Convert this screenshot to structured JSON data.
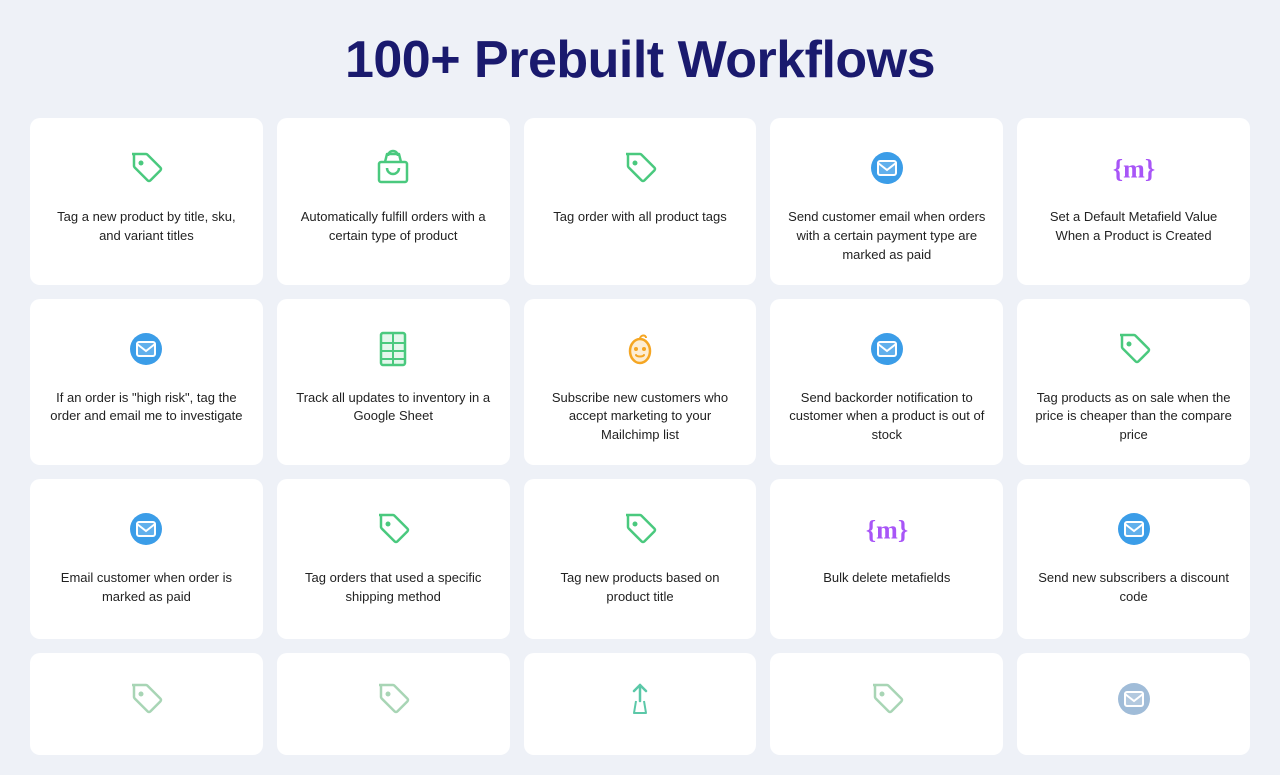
{
  "page": {
    "title": "100+ Prebuilt Workflows"
  },
  "cards": [
    {
      "id": "tag-new-product",
      "icon": "tag",
      "icon_color": "#4ac97e",
      "text": "Tag a new product by title, sku, and variant titles"
    },
    {
      "id": "auto-fulfill",
      "icon": "shopify-bag",
      "icon_color": "#4ac97e",
      "text": "Automatically fulfill orders with a certain type of product"
    },
    {
      "id": "tag-order-product-tags",
      "icon": "tag",
      "icon_color": "#4ac97e",
      "text": "Tag order with all product tags"
    },
    {
      "id": "email-payment-type",
      "icon": "email",
      "icon_color": "#3b9de8",
      "text": "Send customer email when orders with a certain payment type are marked as paid"
    },
    {
      "id": "set-metafield",
      "icon": "metafield",
      "icon_color": "#a855f7",
      "text": "Set a Default Metafield Value When a Product is Created"
    },
    {
      "id": "high-risk-order",
      "icon": "email",
      "icon_color": "#3b9de8",
      "text": "If an order is \"high risk\", tag the order and email me to investigate"
    },
    {
      "id": "track-inventory-sheet",
      "icon": "google-sheet",
      "icon_color": "#4ac97e",
      "text": "Track all updates to inventory in a Google Sheet"
    },
    {
      "id": "mailchimp-subscribe",
      "icon": "mailchimp",
      "icon_color": "#f5a623",
      "text": "Subscribe new customers who accept marketing to your Mailchimp list"
    },
    {
      "id": "backorder-notification",
      "icon": "email",
      "icon_color": "#3b9de8",
      "text": "Send backorder notification to customer when a product is out of stock"
    },
    {
      "id": "tag-on-sale",
      "icon": "tag",
      "icon_color": "#4ac97e",
      "text": "Tag products as on sale when the price is cheaper than the compare price"
    },
    {
      "id": "email-order-paid",
      "icon": "email",
      "icon_color": "#3b9de8",
      "text": "Email customer when order is marked as paid"
    },
    {
      "id": "tag-shipping-method",
      "icon": "tag",
      "icon_color": "#4ac97e",
      "text": "Tag orders that used a specific shipping method"
    },
    {
      "id": "tag-new-products-title",
      "icon": "tag",
      "icon_color": "#4ac97e",
      "text": "Tag new products based on product title"
    },
    {
      "id": "bulk-delete-metafields",
      "icon": "metafield",
      "icon_color": "#a855f7",
      "text": "Bulk delete metafields"
    },
    {
      "id": "new-subscribers-discount",
      "icon": "email",
      "icon_color": "#3b9de8",
      "text": "Send new subscribers a discount code"
    }
  ],
  "bottom_cards": [
    {
      "id": "b1",
      "icon": "tag",
      "icon_color": "#a8d5b5"
    },
    {
      "id": "b2",
      "icon": "tag",
      "icon_color": "#a8d5b5"
    },
    {
      "id": "b3",
      "icon": "touch",
      "icon_color": "#5bc8a8"
    },
    {
      "id": "b4",
      "icon": "tag",
      "icon_color": "#a8d5b5"
    },
    {
      "id": "b5",
      "icon": "email",
      "icon_color": "#a0bcd8"
    }
  ]
}
